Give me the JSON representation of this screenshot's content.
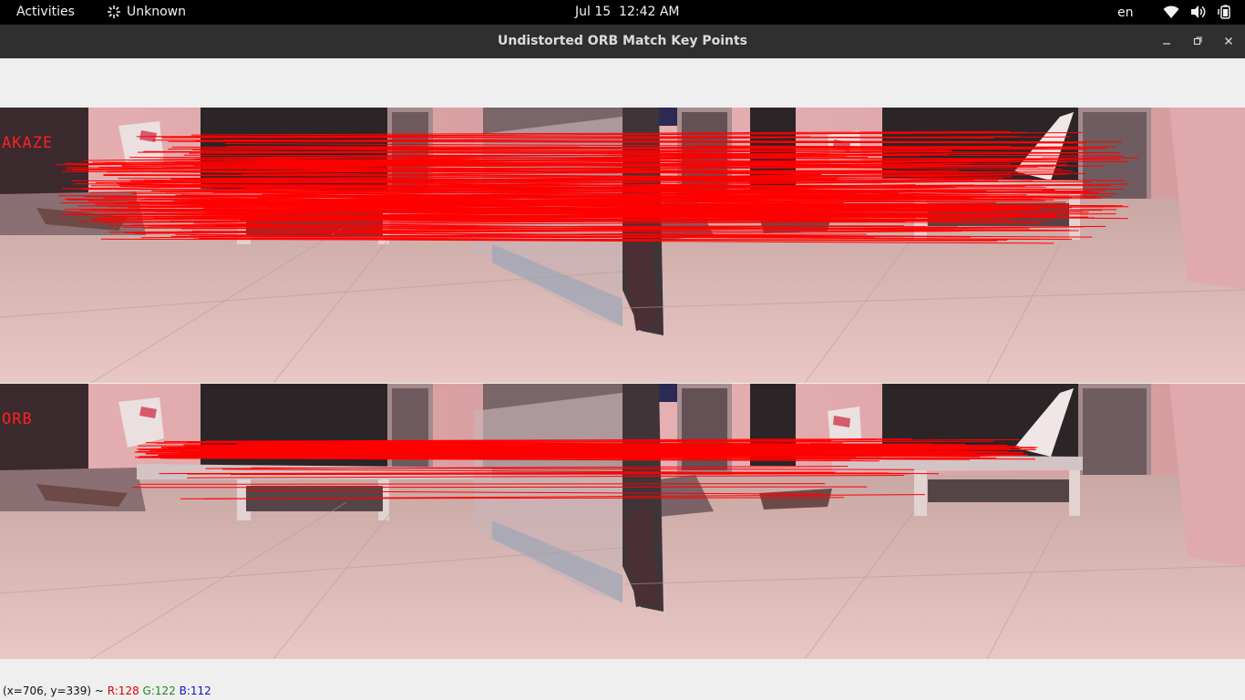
{
  "topbar": {
    "activities": "Activities",
    "app_name": "Unknown",
    "clock": "Jul 15  12:42 AM",
    "language": "en",
    "tray_icons": [
      "wifi-icon",
      "volume-icon",
      "battery-icon"
    ]
  },
  "window": {
    "title": "Undistorted ORB Match Key Points",
    "controls": [
      "minimize",
      "maximize",
      "close"
    ]
  },
  "image": {
    "panels": [
      {
        "label": "AKAZE"
      },
      {
        "label": "ORB"
      }
    ],
    "match_color": "#ff0000"
  },
  "statusbar": {
    "coords": "(x=706, y=339) ~ ",
    "r": "R:128",
    "g": "G:122",
    "b": "B:112"
  }
}
